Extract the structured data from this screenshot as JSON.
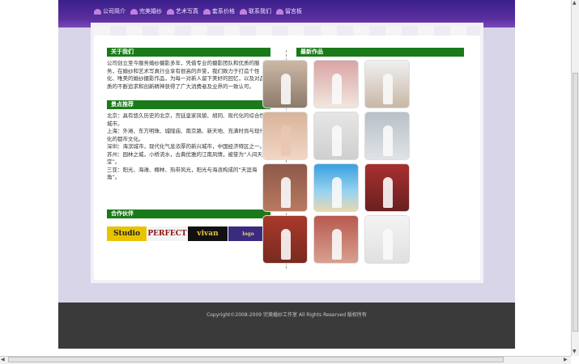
{
  "nav": {
    "items": [
      {
        "label": "公司简介"
      },
      {
        "label": "完美婚纱"
      },
      {
        "label": "艺术写真"
      },
      {
        "label": "套系价格"
      },
      {
        "label": "联系我们"
      },
      {
        "label": "留言板"
      }
    ]
  },
  "about": {
    "title": "关于我们",
    "text": "公司创立至今服务婚纱摄影多年，凭借专业的摄影团队和优质的服务，在婚纱和艺术写真行业享有很高的声誉，我们致力于打造个性化、唯美的婚纱摄影作品，为每一对新人留下美好的回忆，以及对品质的不断追求和创新精神获得了广大消费者及业界的一致认可。"
  },
  "scenic": {
    "title": "景点推荐",
    "lines": [
      "北京：具有悠久历史的北京，宫廷皇家风貌、胡同、现代化的综合性城市。",
      "上海：外滩、东方明珠、城隍庙、南京路、新天地、充满时尚与现代化的都市文化。",
      "深圳：海滨城市，现代化气息浓厚的新兴城市，中国经济特区之一。",
      "苏州：园林之城，小桥流水，古典优雅的江南风情，被誉为“人间天堂”。",
      "三亚：阳光、海滩、椰林、热带风光，阳光与海浪构成的“天涯海角”。"
    ]
  },
  "partners": {
    "title": "合作伙伴",
    "logos": [
      "Studio",
      "PERFECT",
      "vivan",
      "logo"
    ]
  },
  "works": {
    "title": "最新作品"
  },
  "footer": {
    "copyright": "Copyright©2008-2009 完美婚纱工作室 All Rights Reserved 版权所有"
  },
  "colors": {
    "header_green": "#1a7a1a",
    "topbar_purple": "#4b2596",
    "footer": "#3a3a3a"
  }
}
